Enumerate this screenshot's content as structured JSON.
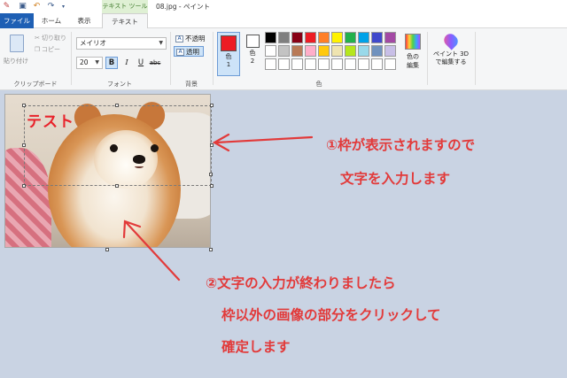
{
  "window": {
    "title": "08.jpg - ペイント",
    "context_tab_group": "テキスト ツール"
  },
  "quick_access": {
    "icons": [
      "paint-app-icon",
      "save-icon",
      "undo-icon",
      "redo-icon",
      "customize-icon"
    ]
  },
  "tabs": [
    {
      "label": "ファイル"
    },
    {
      "label": "ホーム"
    },
    {
      "label": "表示"
    },
    {
      "label": "テキスト",
      "selected": true
    }
  ],
  "ribbon": {
    "clipboard": {
      "paste_label": "貼り付け",
      "cut_label": "切り取り",
      "copy_label": "コピー",
      "group_label": "クリップボード"
    },
    "font": {
      "family": "メイリオ",
      "size": "20",
      "bold": "B",
      "italic": "I",
      "underline": "U",
      "strikethrough": "abc",
      "group_label": "フォント"
    },
    "background": {
      "opaque_label": "不透明",
      "transparent_label": "透明",
      "group_label": "背景"
    },
    "colors": {
      "color1_label": "色\n1",
      "color1_line1": "色",
      "color1_line2": "1",
      "color2_line1": "色",
      "color2_line2": "2",
      "color1": "#ed1c24",
      "color2": "#ffffff",
      "palette_row1": [
        "#000000",
        "#7f7f7f",
        "#880015",
        "#ed1c24",
        "#ff7f27",
        "#fff200",
        "#22b14c",
        "#00a2e8",
        "#3f48cc",
        "#a349a4"
      ],
      "palette_row2": [
        "#ffffff",
        "#c3c3c3",
        "#b97a57",
        "#ffaec9",
        "#ffc90e",
        "#efe4b0",
        "#b5e61d",
        "#99d9ea",
        "#7092be",
        "#c8bfe7"
      ],
      "palette_row3": [
        "#ffffff",
        "#ffffff",
        "#ffffff",
        "#ffffff",
        "#ffffff",
        "#ffffff",
        "#ffffff",
        "#ffffff",
        "#ffffff",
        "#ffffff"
      ],
      "edit_colors_line1": "色の",
      "edit_colors_line2": "編集",
      "group_label": "色"
    },
    "paint3d": {
      "line1": "ペイント 3D",
      "line2": "で編集する"
    }
  },
  "canvas": {
    "text_content": "テスト",
    "annotation_1_line1": "①枠が表示されますので",
    "annotation_1_line2": "文字を入力します",
    "annotation_2_line1": "②文字の入力が終わりましたら",
    "annotation_2_line2": "枠以外の画像の部分をクリックして",
    "annotation_2_line3": "確定します",
    "annotation_color": "#e23a3a"
  }
}
